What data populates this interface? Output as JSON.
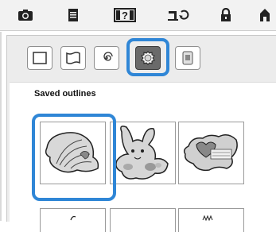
{
  "tabs": [
    {
      "icon": "camera-icon"
    },
    {
      "icon": "document-icon"
    },
    {
      "icon": "help-icon",
      "label": "?"
    },
    {
      "icon": "sewing-machine-icon"
    },
    {
      "icon": "lock-icon"
    },
    {
      "icon": "home-icon"
    }
  ],
  "subtabs": [
    {
      "icon": "square-outline-icon"
    },
    {
      "icon": "wavy-outline-icon"
    },
    {
      "icon": "spiral-outline-icon"
    },
    {
      "icon": "saved-outline-icon",
      "selected": true
    },
    {
      "icon": "card-icon"
    }
  ],
  "section": {
    "title": "Saved outlines"
  },
  "outlines": [
    {
      "icon": "shell-outline-icon",
      "selected": true
    },
    {
      "icon": "rabbit-outline-icon"
    },
    {
      "icon": "heart-flag-outline-icon"
    },
    {
      "icon": "partial-outline-icon"
    },
    {
      "icon": "partial-outline-icon"
    },
    {
      "icon": "partial-outline-icon"
    }
  ],
  "colors": {
    "highlight": "#2f86d6",
    "panel": "#ececec",
    "selected_tab": "#6a6a6a"
  }
}
